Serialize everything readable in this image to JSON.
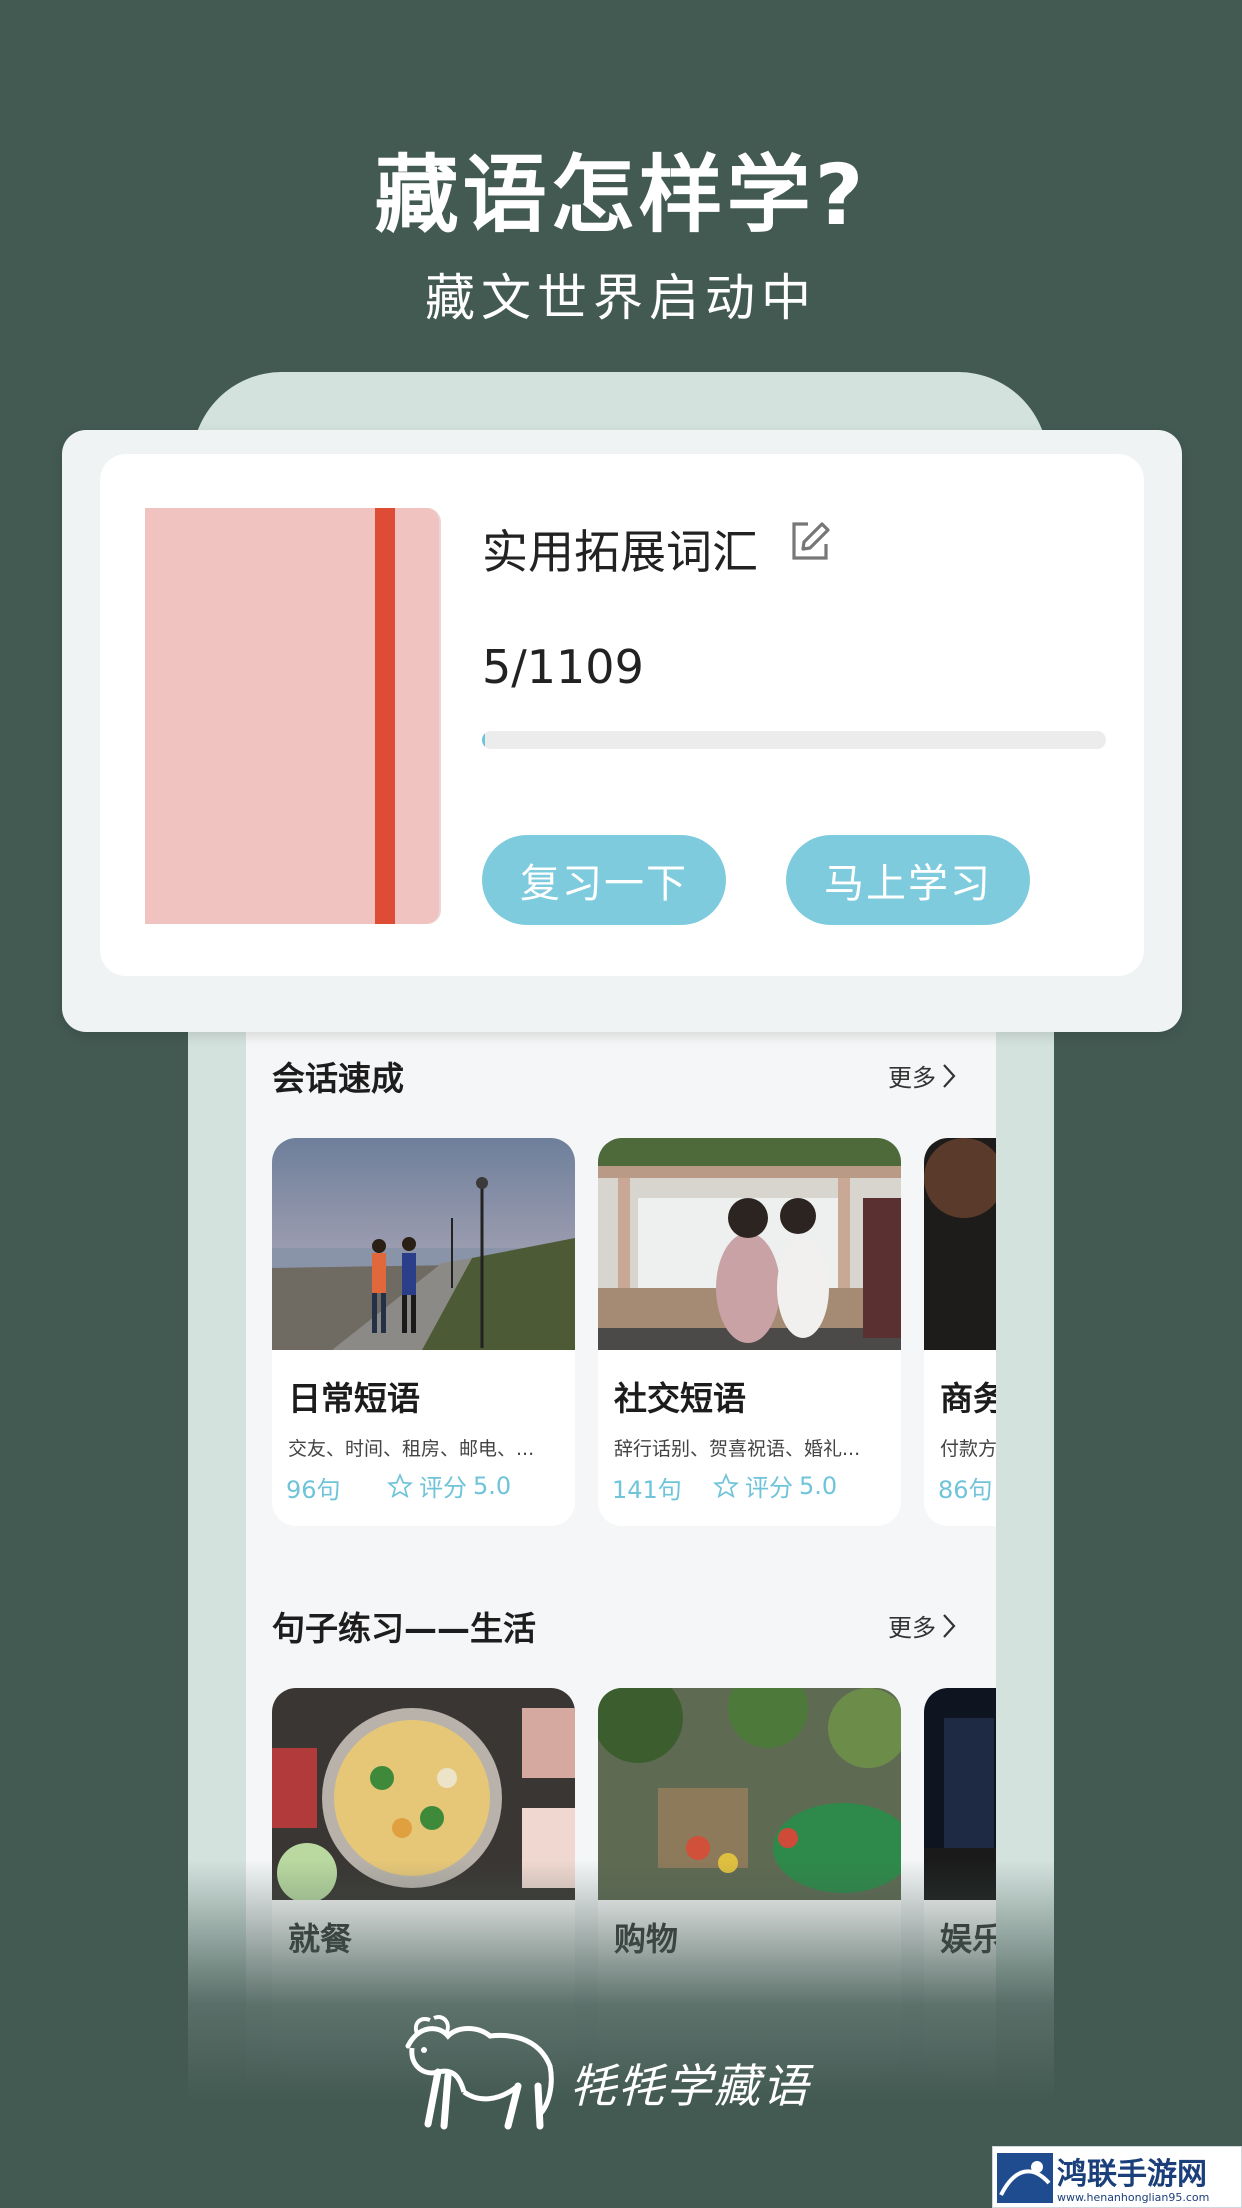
{
  "hero": {
    "title": "藏语怎样学?",
    "subtitle": "藏文世界启动中"
  },
  "vocab_card": {
    "title": "实用拓展词汇",
    "progress_text": "5/1109",
    "progress_fraction": 0.0045,
    "review_button": "复习一下",
    "study_button": "马上学习",
    "icons": {
      "edit": "edit-icon"
    }
  },
  "sections": [
    {
      "title": "会话速成",
      "more": "更多",
      "cards": [
        {
          "title": "日常短语",
          "desc": "交友、时间、租房、邮电、...",
          "count": "96句",
          "rating_label": "评分",
          "rating": "5.0",
          "photo": "seaside-walk-photo"
        },
        {
          "title": "社交短语",
          "desc": "辞行话别、贺喜祝语、婚礼...",
          "count": "141句",
          "rating_label": "评分",
          "rating": "5.0",
          "photo": "friends-sitting-photo"
        },
        {
          "title": "商务",
          "desc": "付款方",
          "count": "86句",
          "photo": "business-photo"
        }
      ]
    },
    {
      "title": "句子练习——生活",
      "more": "更多",
      "cards": [
        {
          "title": "就餐",
          "photo": "hotpot-photo"
        },
        {
          "title": "购物",
          "photo": "market-photo"
        },
        {
          "title": "娱乐",
          "photo": "theater-photo"
        }
      ]
    }
  ],
  "brand": {
    "logo_text": "牦牦学藏语",
    "logo_icon": "yak-logo-icon"
  },
  "watermark": {
    "title": "鸿联手游网",
    "url": "www.henanhonglian95.com"
  },
  "colors": {
    "background": "#435a53",
    "accent": "#7ecbde",
    "book_cover": "#f0c3c0",
    "book_ribbon": "#de4c35",
    "phone_frame": "#d4e2de"
  }
}
